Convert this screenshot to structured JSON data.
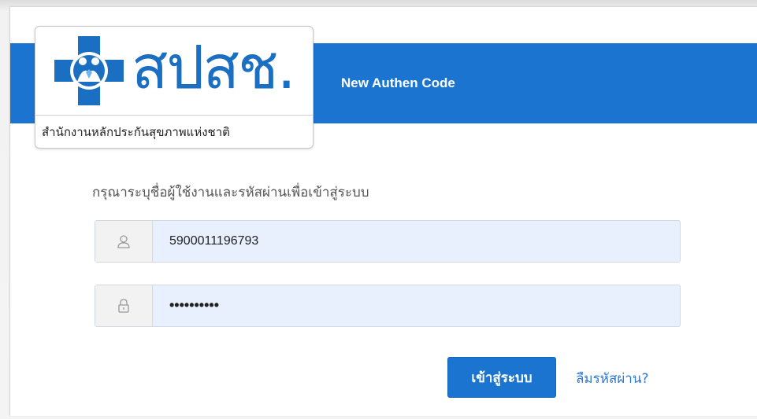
{
  "header": {
    "title": "New Authen Code"
  },
  "logo": {
    "wordmark": "สปสช.",
    "subtitle": "สำนักงานหลักประกันสุขภาพแห่งชาติ",
    "emblem_icon": "nhso-cross-emblem-icon"
  },
  "form": {
    "instruction": "กรุณาระบุชื่อผู้ใช้งานและรหัสผ่านเพื่อเข้าสู่ระบบ",
    "username": {
      "icon": "user-icon",
      "value": "5900011196793"
    },
    "password": {
      "icon": "lock-icon",
      "value": "••••••••••"
    },
    "login_label": "เข้าสู่ระบบ",
    "forgot_label": "ลืมรหัสผ่าน?"
  },
  "colors": {
    "brand_blue": "#1b75d0",
    "input_bg": "#e8f0fe",
    "link": "#2a7ad4"
  }
}
